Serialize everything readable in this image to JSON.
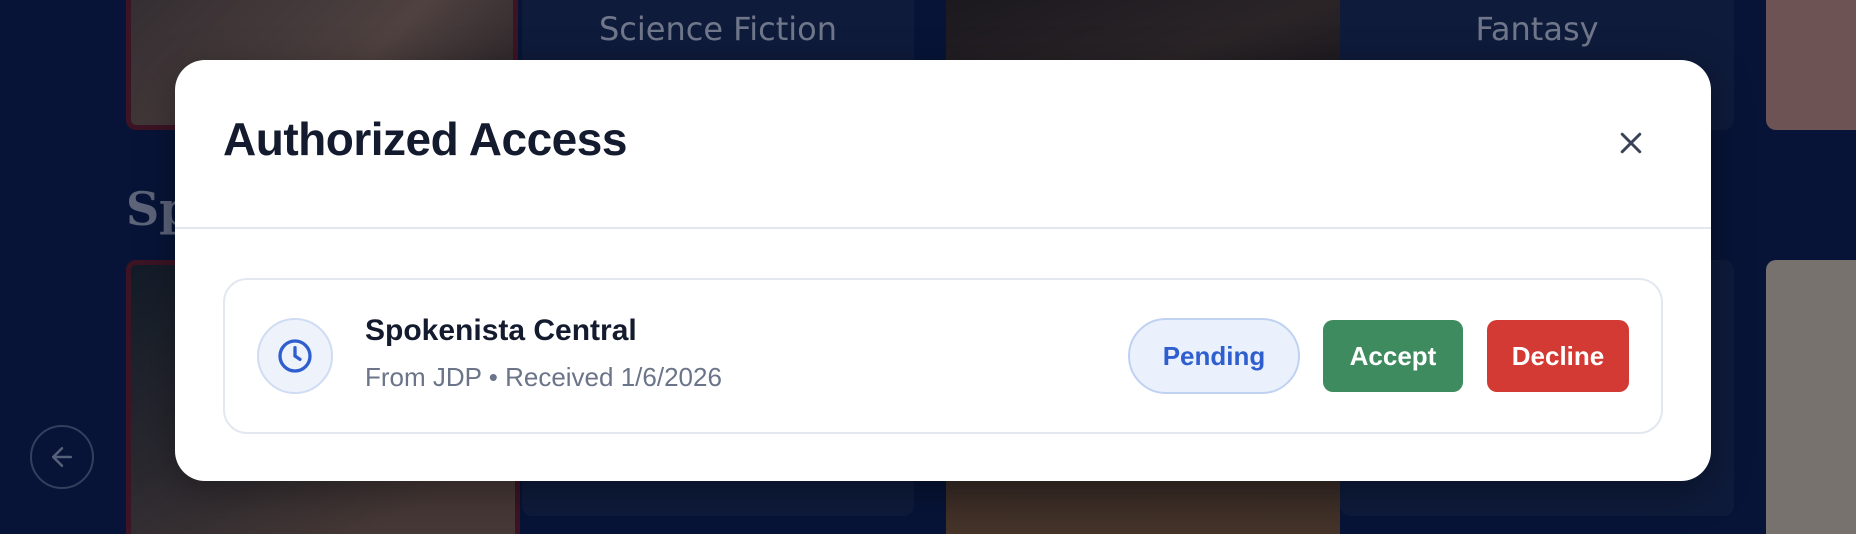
{
  "background": {
    "genres": [
      "Science Fiction",
      "Fantasy"
    ],
    "section_heading": "Sp"
  },
  "modal": {
    "title": "Authorized Access",
    "close_icon": "close-icon",
    "request": {
      "icon": "clock-icon",
      "name": "Spokenista Central",
      "meta": "From JDP • Received 1/6/2026",
      "status": "Pending",
      "accept_label": "Accept",
      "decline_label": "Decline"
    }
  },
  "colors": {
    "accept": "#3d8b5e",
    "decline": "#d33a33",
    "pending_text": "#2f5fcf",
    "page_background": "#0a1c47"
  }
}
